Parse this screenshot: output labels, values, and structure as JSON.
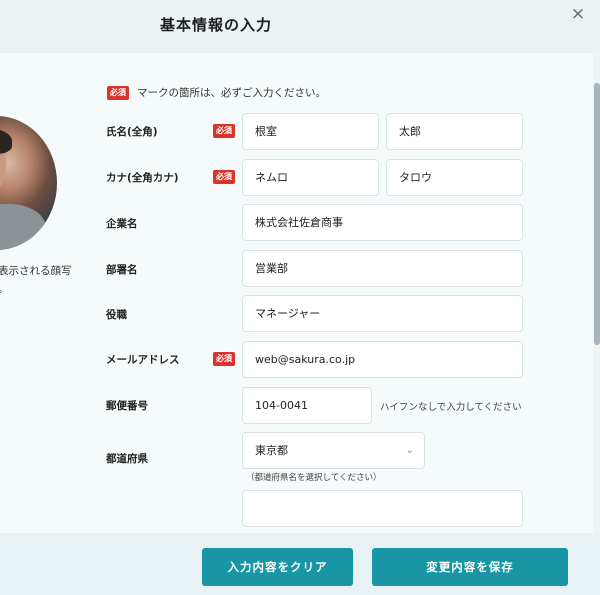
{
  "header": {
    "title": "基本情報の入力",
    "close_symbol": "×"
  },
  "avatar": {
    "caption_line1": "表示される顔写",
    "caption_line2": "。"
  },
  "form": {
    "required_badge": "必須",
    "note_text": "マークの箇所は、必ずご入力ください。",
    "name": {
      "label": "氏名(全角)",
      "last": "根室",
      "first": "太郎"
    },
    "kana": {
      "label": "カナ(全角カナ)",
      "last": "ネムロ",
      "first": "タロウ"
    },
    "company": {
      "label": "企業名",
      "value": "株式会社佐倉商事"
    },
    "department": {
      "label": "部署名",
      "value": "営業部"
    },
    "position": {
      "label": "役職",
      "value": "マネージャー"
    },
    "email": {
      "label": "メールアドレス",
      "value": "web@sakura.co.jp"
    },
    "postal": {
      "label": "郵便番号",
      "value": "104-0041",
      "hint": "ハイフンなしで入力してください"
    },
    "prefecture": {
      "label": "都道府県",
      "value": "東京都",
      "hint": "（都道府県名を選択してください）"
    }
  },
  "footer": {
    "clear_label": "入力内容をクリア",
    "save_label": "変更内容を保存"
  },
  "colors": {
    "accent": "#1996a3",
    "required": "#d9342b"
  }
}
